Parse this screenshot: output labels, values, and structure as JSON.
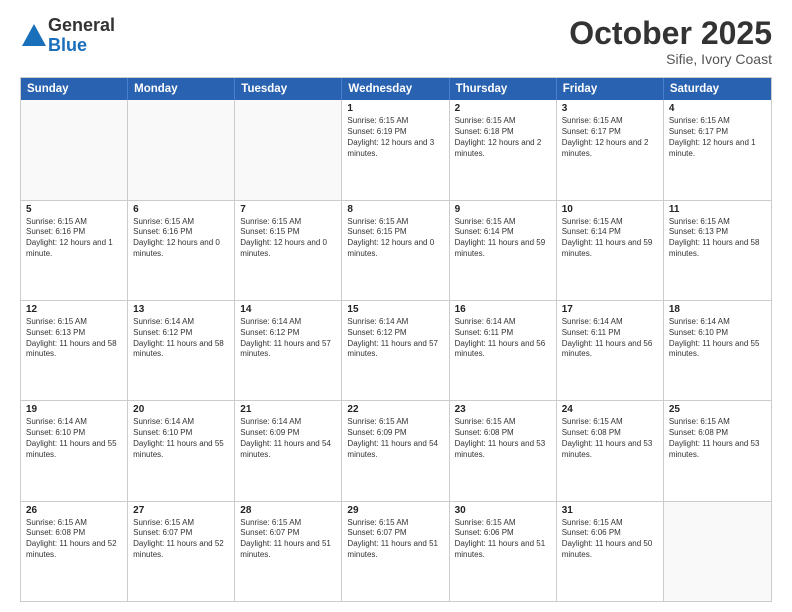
{
  "header": {
    "logo_general": "General",
    "logo_blue": "Blue",
    "month": "October 2025",
    "location": "Sifie, Ivory Coast"
  },
  "days_of_week": [
    "Sunday",
    "Monday",
    "Tuesday",
    "Wednesday",
    "Thursday",
    "Friday",
    "Saturday"
  ],
  "weeks": [
    [
      {
        "day": "",
        "info": ""
      },
      {
        "day": "",
        "info": ""
      },
      {
        "day": "",
        "info": ""
      },
      {
        "day": "1",
        "info": "Sunrise: 6:15 AM\nSunset: 6:19 PM\nDaylight: 12 hours and 3 minutes."
      },
      {
        "day": "2",
        "info": "Sunrise: 6:15 AM\nSunset: 6:18 PM\nDaylight: 12 hours and 2 minutes."
      },
      {
        "day": "3",
        "info": "Sunrise: 6:15 AM\nSunset: 6:17 PM\nDaylight: 12 hours and 2 minutes."
      },
      {
        "day": "4",
        "info": "Sunrise: 6:15 AM\nSunset: 6:17 PM\nDaylight: 12 hours and 1 minute."
      }
    ],
    [
      {
        "day": "5",
        "info": "Sunrise: 6:15 AM\nSunset: 6:16 PM\nDaylight: 12 hours and 1 minute."
      },
      {
        "day": "6",
        "info": "Sunrise: 6:15 AM\nSunset: 6:16 PM\nDaylight: 12 hours and 0 minutes."
      },
      {
        "day": "7",
        "info": "Sunrise: 6:15 AM\nSunset: 6:15 PM\nDaylight: 12 hours and 0 minutes."
      },
      {
        "day": "8",
        "info": "Sunrise: 6:15 AM\nSunset: 6:15 PM\nDaylight: 12 hours and 0 minutes."
      },
      {
        "day": "9",
        "info": "Sunrise: 6:15 AM\nSunset: 6:14 PM\nDaylight: 11 hours and 59 minutes."
      },
      {
        "day": "10",
        "info": "Sunrise: 6:15 AM\nSunset: 6:14 PM\nDaylight: 11 hours and 59 minutes."
      },
      {
        "day": "11",
        "info": "Sunrise: 6:15 AM\nSunset: 6:13 PM\nDaylight: 11 hours and 58 minutes."
      }
    ],
    [
      {
        "day": "12",
        "info": "Sunrise: 6:15 AM\nSunset: 6:13 PM\nDaylight: 11 hours and 58 minutes."
      },
      {
        "day": "13",
        "info": "Sunrise: 6:14 AM\nSunset: 6:12 PM\nDaylight: 11 hours and 58 minutes."
      },
      {
        "day": "14",
        "info": "Sunrise: 6:14 AM\nSunset: 6:12 PM\nDaylight: 11 hours and 57 minutes."
      },
      {
        "day": "15",
        "info": "Sunrise: 6:14 AM\nSunset: 6:12 PM\nDaylight: 11 hours and 57 minutes."
      },
      {
        "day": "16",
        "info": "Sunrise: 6:14 AM\nSunset: 6:11 PM\nDaylight: 11 hours and 56 minutes."
      },
      {
        "day": "17",
        "info": "Sunrise: 6:14 AM\nSunset: 6:11 PM\nDaylight: 11 hours and 56 minutes."
      },
      {
        "day": "18",
        "info": "Sunrise: 6:14 AM\nSunset: 6:10 PM\nDaylight: 11 hours and 55 minutes."
      }
    ],
    [
      {
        "day": "19",
        "info": "Sunrise: 6:14 AM\nSunset: 6:10 PM\nDaylight: 11 hours and 55 minutes."
      },
      {
        "day": "20",
        "info": "Sunrise: 6:14 AM\nSunset: 6:10 PM\nDaylight: 11 hours and 55 minutes."
      },
      {
        "day": "21",
        "info": "Sunrise: 6:14 AM\nSunset: 6:09 PM\nDaylight: 11 hours and 54 minutes."
      },
      {
        "day": "22",
        "info": "Sunrise: 6:15 AM\nSunset: 6:09 PM\nDaylight: 11 hours and 54 minutes."
      },
      {
        "day": "23",
        "info": "Sunrise: 6:15 AM\nSunset: 6:08 PM\nDaylight: 11 hours and 53 minutes."
      },
      {
        "day": "24",
        "info": "Sunrise: 6:15 AM\nSunset: 6:08 PM\nDaylight: 11 hours and 53 minutes."
      },
      {
        "day": "25",
        "info": "Sunrise: 6:15 AM\nSunset: 6:08 PM\nDaylight: 11 hours and 53 minutes."
      }
    ],
    [
      {
        "day": "26",
        "info": "Sunrise: 6:15 AM\nSunset: 6:08 PM\nDaylight: 11 hours and 52 minutes."
      },
      {
        "day": "27",
        "info": "Sunrise: 6:15 AM\nSunset: 6:07 PM\nDaylight: 11 hours and 52 minutes."
      },
      {
        "day": "28",
        "info": "Sunrise: 6:15 AM\nSunset: 6:07 PM\nDaylight: 11 hours and 51 minutes."
      },
      {
        "day": "29",
        "info": "Sunrise: 6:15 AM\nSunset: 6:07 PM\nDaylight: 11 hours and 51 minutes."
      },
      {
        "day": "30",
        "info": "Sunrise: 6:15 AM\nSunset: 6:06 PM\nDaylight: 11 hours and 51 minutes."
      },
      {
        "day": "31",
        "info": "Sunrise: 6:15 AM\nSunset: 6:06 PM\nDaylight: 11 hours and 50 minutes."
      },
      {
        "day": "",
        "info": ""
      }
    ]
  ]
}
